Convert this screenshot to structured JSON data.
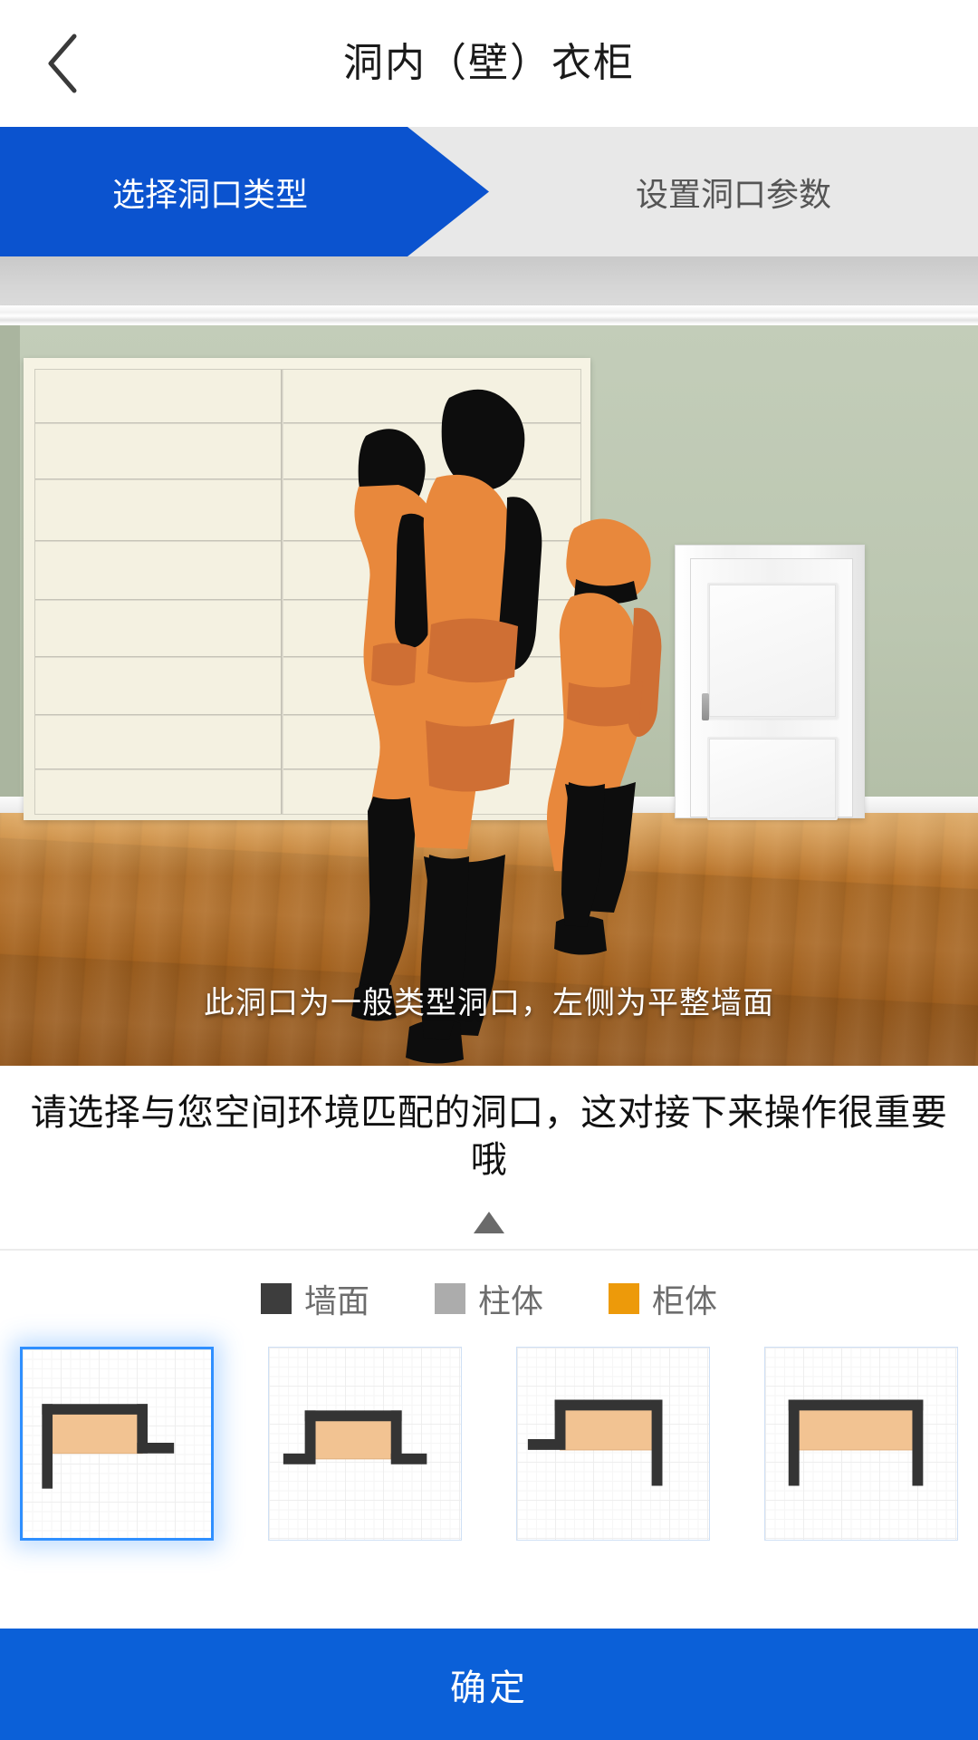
{
  "header": {
    "title": "洞内（壁）衣柜",
    "back_icon": "chevron-left-icon"
  },
  "steps": [
    {
      "label": "选择洞口类型",
      "active": true
    },
    {
      "label": "设置洞口参数",
      "active": false
    }
  ],
  "scene": {
    "caption": "此洞口为一般类型洞口，左侧为平整墙面",
    "alt": "房间效果图：一家三口站在衣柜前",
    "colors": {
      "wall": "#bcc7b1",
      "ceiling": "#d6d6d6",
      "floor": "#a5631f",
      "wardrobe": "#f4f1e1",
      "door": "#fafafa",
      "figure_cloth": "#e8883c",
      "figure_body": "#0d0d0d"
    }
  },
  "instruction": "请选择与您空间环境匹配的洞口，这对接下来操作很重要哦",
  "collapse": {
    "icon": "triangle-up-icon"
  },
  "legend": [
    {
      "label": "墙面",
      "color": "#3d3d3d",
      "key": "wall"
    },
    {
      "label": "柱体",
      "color": "#acacac",
      "key": "pillar"
    },
    {
      "label": "柜体",
      "color": "#ed9a0a",
      "key": "cabinet"
    }
  ],
  "options": [
    {
      "id": "opt-1",
      "name": "left-flat-wall-right-stub",
      "selected": true
    },
    {
      "id": "opt-2",
      "name": "both-side-stubs-pedestal",
      "selected": false
    },
    {
      "id": "opt-3",
      "name": "left-stub-right-flat-wall",
      "selected": false
    },
    {
      "id": "opt-4",
      "name": "both-side-flat-walls",
      "selected": false
    }
  ],
  "confirm": {
    "label": "确定",
    "color": "#0b60d8"
  },
  "theme": {
    "primary": "#0b53cf",
    "confirm": "#0b60d8",
    "selected_border": "#2f8fff",
    "tab_inactive_bg": "#e8e8e8"
  }
}
